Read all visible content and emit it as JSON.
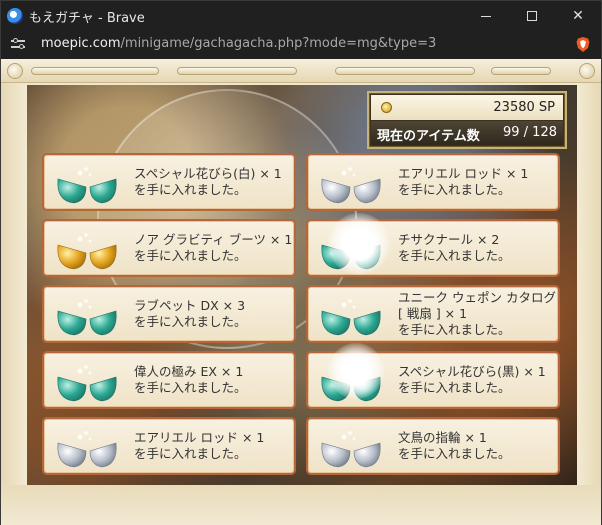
{
  "window": {
    "title": "もえガチャ - Brave",
    "minimize_glyph": "minimize-icon",
    "maximize_glyph": "maximize-icon",
    "close_glyph": "✕"
  },
  "addressbar": {
    "host": "moepic.com",
    "path": "/minigame/gachagacha.php?mode=mg&type=3"
  },
  "status": {
    "sp_value": "23580 SP",
    "items_label": "現在のアイテム数",
    "items_count": "99 / 128"
  },
  "results": [
    {
      "name": "スペシャル花びら(白) × 1",
      "suffix": "を手に入れました。",
      "egg": "teal"
    },
    {
      "name": "エアリエル ロッド × 1",
      "suffix": "を手に入れました。",
      "egg": "silver"
    },
    {
      "name": "ノア グラビティ ブーツ × 1",
      "suffix": "を手に入れました。",
      "egg": "gold"
    },
    {
      "name": "チサクナール × 2",
      "suffix": "を手に入れました。",
      "egg": "teal"
    },
    {
      "name": "ラブペット DX × 3",
      "suffix": "を手に入れました。",
      "egg": "teal"
    },
    {
      "name": "ユニーク ウェポン カタログ [ 戦扇 ] × 1",
      "suffix": "を手に入れました。",
      "egg": "teal"
    },
    {
      "name": "偉人の極み EX × 1",
      "suffix": "を手に入れました。",
      "egg": "teal"
    },
    {
      "name": "スペシャル花びら(黒) × 1",
      "suffix": "を手に入れました。",
      "egg": "teal"
    },
    {
      "name": "エアリエル ロッド × 1",
      "suffix": "を手に入れました。",
      "egg": "silver"
    },
    {
      "name": "文鳥の指輪 × 1",
      "suffix": "を手に入れました。",
      "egg": "silver"
    }
  ],
  "colors": {
    "teal": [
      "#bff0e4",
      "#2aa892",
      "#1f6f63"
    ],
    "silver": [
      "#ffffff",
      "#b8c0cc",
      "#6f7785"
    ],
    "gold": [
      "#fff1a6",
      "#e3a31c",
      "#9c6a0c"
    ]
  }
}
